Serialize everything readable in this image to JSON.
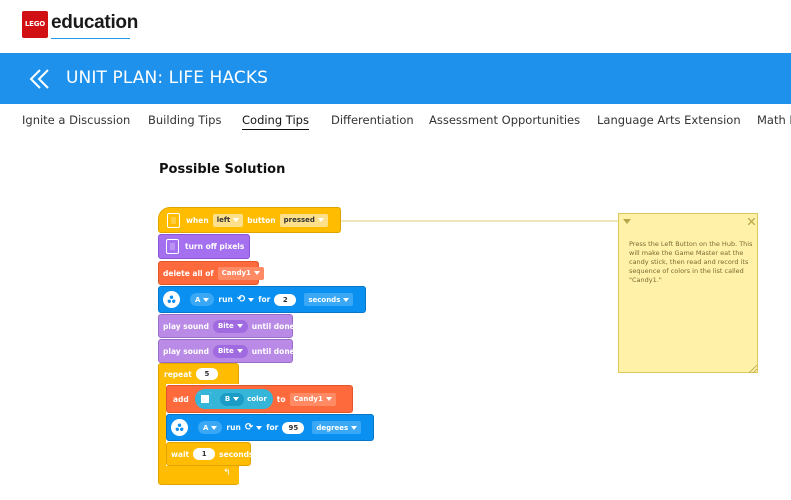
{
  "brand": {
    "lego": "LEGO",
    "education": "education"
  },
  "banner": {
    "title": "UNIT PLAN: LIFE HACKS",
    "back_icon": "double-chevron-left-icon"
  },
  "tabs": [
    {
      "label": "Ignite a Discussion"
    },
    {
      "label": "Building Tips"
    },
    {
      "label": "Coding Tips",
      "active": true
    },
    {
      "label": "Differentiation"
    },
    {
      "label": "Assessment Opportunities"
    },
    {
      "label": "Language Arts Extension"
    },
    {
      "label": "Math E"
    }
  ],
  "section": {
    "title": "Possible Solution"
  },
  "code": {
    "when": {
      "when": "when",
      "button_side": "left",
      "button": "button",
      "state": "pressed"
    },
    "turn_off": "turn off pixels",
    "delete_all": {
      "label": "delete all of",
      "list": "Candy1"
    },
    "run1": {
      "port": "A",
      "run": "run",
      "for": "for",
      "amount": "2",
      "unit": "seconds"
    },
    "play1": {
      "label": "play sound",
      "sound": "Bite",
      "until": "until done"
    },
    "play2": {
      "label": "play sound",
      "sound": "Bite",
      "until": "until done"
    },
    "repeat": {
      "label": "repeat",
      "count": "5"
    },
    "add": {
      "label": "add",
      "port": "B",
      "color": "color",
      "to": "to",
      "list": "Candy1"
    },
    "run2": {
      "port": "A",
      "run": "run",
      "for": "for",
      "amount": "95",
      "unit": "degrees"
    },
    "wait": {
      "label": "wait",
      "amount": "1",
      "unit": "seconds"
    }
  },
  "note": {
    "text": "Press the Left Button on the Hub. This will make the Game Master eat the candy stick, then read and record its sequence of colors in the list called \"Candy1.\"",
    "collapse_icon": "triangle-down-icon",
    "close_icon": "close-icon"
  },
  "colors": {
    "banner": "#1e91ec",
    "events": "#ffbc00",
    "light": "#a470f0",
    "variables": "#ff6a3c",
    "motors": "#0a90f0",
    "sound": "#b98be6"
  }
}
